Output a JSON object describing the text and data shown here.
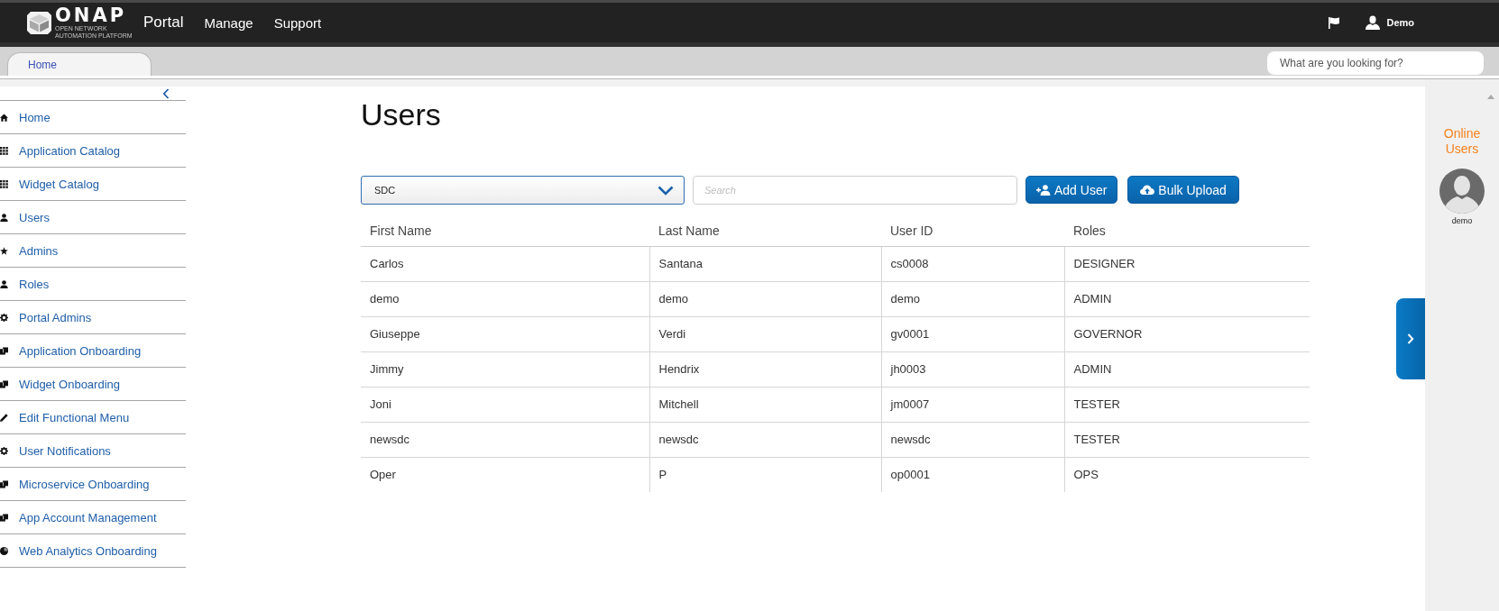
{
  "header": {
    "logo": {
      "wordmark": "ONAP",
      "tagline": "OPEN NETWORK AUTOMATION PLATFORM"
    },
    "app_name": "Portal",
    "nav": [
      "Manage",
      "Support"
    ],
    "user": "Demo"
  },
  "tabs": [
    {
      "label": "Home",
      "selected": true
    }
  ],
  "site_search": {
    "placeholder": "What are you looking for?"
  },
  "sidebar": {
    "items": [
      {
        "label": "Home",
        "kind": "home"
      },
      {
        "label": "Application Catalog",
        "kind": "grid"
      },
      {
        "label": "Widget Catalog",
        "kind": "grid"
      },
      {
        "label": "Users",
        "kind": "person"
      },
      {
        "label": "Admins",
        "kind": "star"
      },
      {
        "label": "Roles",
        "kind": "person"
      },
      {
        "label": "Portal Admins",
        "kind": "gear"
      },
      {
        "label": "Application Onboarding",
        "kind": "stack"
      },
      {
        "label": "Widget Onboarding",
        "kind": "stack"
      },
      {
        "label": "Edit Functional Menu",
        "kind": "pencil"
      },
      {
        "label": "User Notifications",
        "kind": "gear"
      },
      {
        "label": "Microservice Onboarding",
        "kind": "stack"
      },
      {
        "label": "App Account Management",
        "kind": "stack"
      },
      {
        "label": "Web Analytics Onboarding",
        "kind": "pie"
      }
    ]
  },
  "page_title": "Users",
  "app_select": {
    "value": "SDC"
  },
  "user_search": {
    "placeholder": "Search"
  },
  "buttons": [
    {
      "label": "Add User",
      "kind": "add-user"
    },
    {
      "label": "Bulk Upload",
      "kind": "upload"
    }
  ],
  "table": {
    "columns": [
      "First Name",
      "Last Name",
      "User ID",
      "Roles"
    ],
    "rows": [
      [
        "Carlos",
        "Santana",
        "cs0008",
        "DESIGNER"
      ],
      [
        "demo",
        "demo",
        "demo",
        "ADMIN"
      ],
      [
        "Giuseppe",
        "Verdi",
        "gv0001",
        "GOVERNOR"
      ],
      [
        "Jimmy",
        "Hendrix",
        "jh0003",
        "ADMIN"
      ],
      [
        "Joni",
        "Mitchell",
        "jm0007",
        "TESTER"
      ],
      [
        "newsdc",
        "newsdc",
        "newsdc",
        "TESTER"
      ],
      [
        "Oper",
        "P",
        "op0001",
        "OPS"
      ]
    ]
  },
  "online_users": {
    "title": "Online Users",
    "users": [
      {
        "name": "demo"
      }
    ]
  }
}
